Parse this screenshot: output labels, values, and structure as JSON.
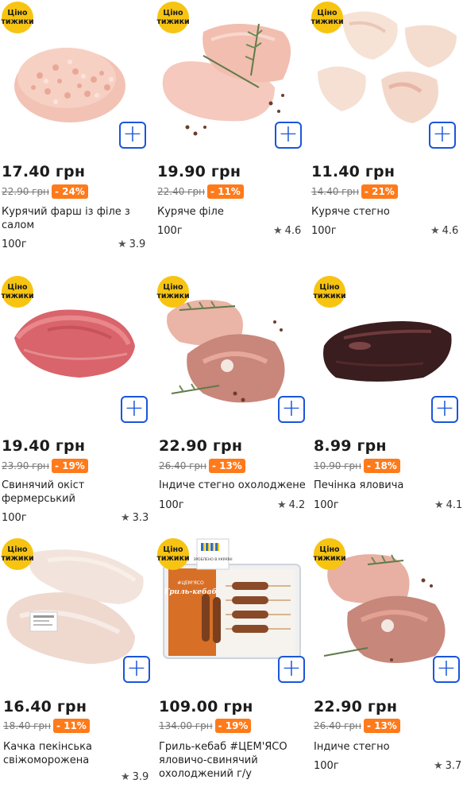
{
  "badge_text": [
    "Ціно",
    "тижики"
  ],
  "colors": {
    "accent": "#1a56db",
    "discount": "#ff7a1a",
    "badge": "#f7c412"
  },
  "products": [
    {
      "price": "17.40 грн",
      "old_price": "22.90 грн",
      "discount": "- 24%",
      "name": "Курячий фарш із філе з салом",
      "weight": "100г",
      "rating": "3.9"
    },
    {
      "price": "19.90 грн",
      "old_price": "22.40 грн",
      "discount": "- 11%",
      "name": "Куряче філе",
      "weight": "100г",
      "rating": "4.6"
    },
    {
      "price": "11.40 грн",
      "old_price": "14.40 грн",
      "discount": "- 21%",
      "name": "Куряче стегно",
      "weight": "100г",
      "rating": "4.6"
    },
    {
      "price": "19.40 грн",
      "old_price": "23.90 грн",
      "discount": "- 19%",
      "name": "Свинячий окіст фермерський",
      "weight": "100г",
      "rating": "3.3"
    },
    {
      "price": "22.90 грн",
      "old_price": "26.40 грн",
      "discount": "- 13%",
      "name": "Індиче стегно охолоджене",
      "weight": "100г",
      "rating": "4.2"
    },
    {
      "price": "8.99 грн",
      "old_price": "10.90 грн",
      "discount": "- 18%",
      "name": "Печінка яловича",
      "weight": "100г",
      "rating": "4.1"
    },
    {
      "price": "16.40 грн",
      "old_price": "18.40 грн",
      "discount": "- 11%",
      "name": "Качка пекінська свіжоморожена",
      "weight": "",
      "rating": "3.9"
    },
    {
      "price": "109.00 грн",
      "old_price": "134.00 грн",
      "discount": "- 19%",
      "name": "Гриль-кебаб #ЦЕМ'ЯСО яловичо-свинячий охолоджений г/у",
      "weight": "",
      "rating": ""
    },
    {
      "price": "22.90 грн",
      "old_price": "26.40 грн",
      "discount": "- 13%",
      "name": "Індиче стегно",
      "weight": "100г",
      "rating": "3.7"
    }
  ],
  "package": {
    "brand": "#ЦЕМ'ЯСО",
    "title": "Гриль-кебаб",
    "made_in": "ЗРОБЛЕНО В УКРАЇНІ"
  }
}
